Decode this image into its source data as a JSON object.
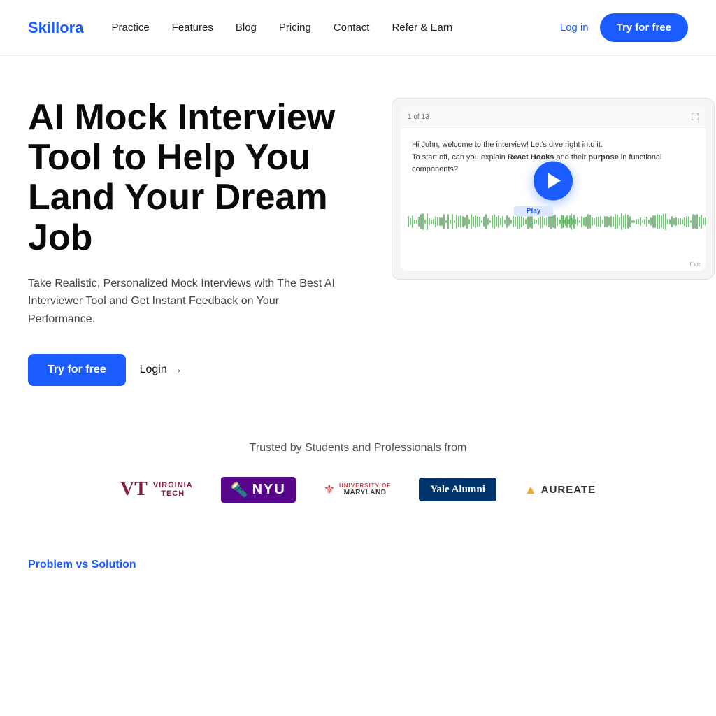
{
  "brand": {
    "name": "Skillora",
    "color": "#1a5cff"
  },
  "nav": {
    "links": [
      {
        "label": "Practice",
        "id": "practice"
      },
      {
        "label": "Features",
        "id": "features"
      },
      {
        "label": "Blog",
        "id": "blog"
      },
      {
        "label": "Pricing",
        "id": "pricing"
      },
      {
        "label": "Contact",
        "id": "contact"
      },
      {
        "label": "Refer & Earn",
        "id": "refer"
      }
    ],
    "login_label": "Log in",
    "cta_label": "Try for free"
  },
  "hero": {
    "title": "AI Mock Interview Tool to Help You Land Your Dream Job",
    "description": "Take Realistic, Personalized Mock Interviews with The Best AI Interviewer Tool and Get Instant Feedback on Your Performance.",
    "cta_primary": "Try for free",
    "cta_secondary": "Login",
    "video": {
      "counter": "1 of 13",
      "chat_text_line1": "Hi John, welcome to the interview! Let's dive right into it.",
      "chat_text_line2": "To start off, can you explain ",
      "chat_bold1": "React Hooks",
      "chat_text_line3": " and their ",
      "chat_bold2": "purpose",
      "chat_text_line4": " in functional components?",
      "play_label": "Play",
      "exit_label": "Exit"
    }
  },
  "trusted": {
    "label": "Trusted by Students and Professionals from",
    "logos": [
      {
        "name": "Virginia Tech",
        "id": "virginia-tech"
      },
      {
        "name": "NYU",
        "id": "nyu"
      },
      {
        "name": "University of Maryland",
        "id": "umd"
      },
      {
        "name": "Yale Alumni",
        "id": "yale"
      },
      {
        "name": "Aureate",
        "id": "aureate"
      }
    ]
  },
  "problem_section": {
    "label": "Problem vs Solution"
  }
}
